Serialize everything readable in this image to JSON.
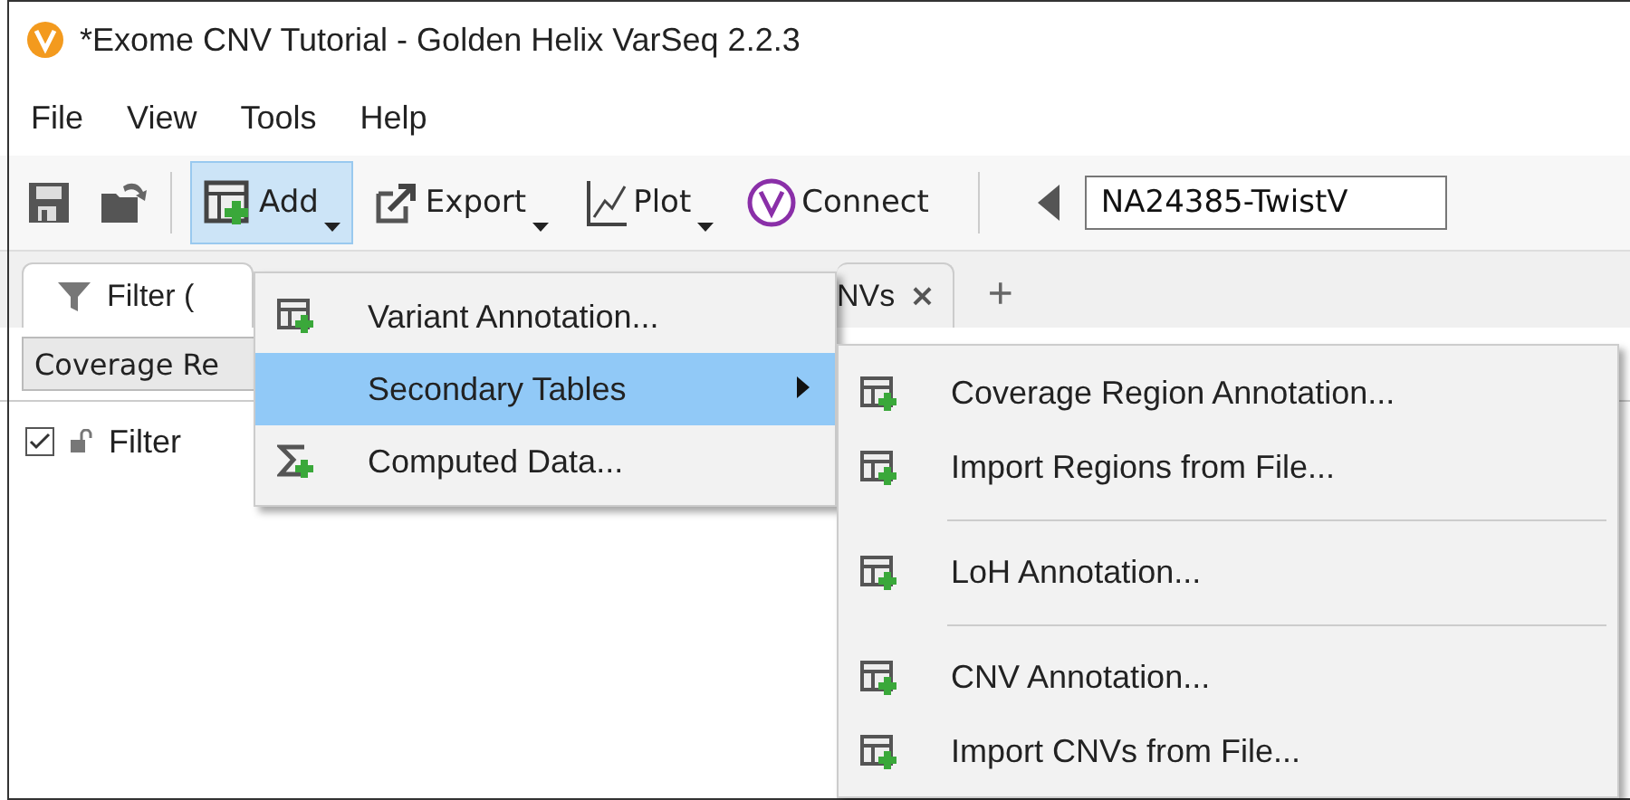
{
  "window": {
    "title": "*Exome CNV Tutorial - Golden Helix VarSeq 2.2.3"
  },
  "menu_bar": [
    {
      "label": "File"
    },
    {
      "label": "View"
    },
    {
      "label": "Tools"
    },
    {
      "label": "Help"
    }
  ],
  "toolbar": {
    "buttons": [
      {
        "kind": "add",
        "label": "Add",
        "selected": true,
        "dropdown": true
      },
      {
        "kind": "export",
        "label": "Export",
        "selected": false,
        "dropdown": true
      },
      {
        "kind": "plot",
        "label": "Plot",
        "selected": false,
        "dropdown": true
      },
      {
        "kind": "connect",
        "label": "Connect",
        "selected": false,
        "dropdown": false
      }
    ],
    "sample_field": {
      "value": "NA24385-TwistV"
    }
  },
  "tabs": [
    {
      "label": "Filter (",
      "selected": true
    },
    {
      "label": "NVs",
      "selected": false,
      "close": "×"
    }
  ],
  "add_tab": "+",
  "filter_bar": {
    "button": "Coverage Re"
  },
  "filter_row": {
    "checked": true,
    "label": "Filter"
  },
  "add_menu": [
    {
      "label": "Variant Annotation...",
      "kind": "table",
      "selected": false,
      "submenu": false
    },
    {
      "label": "Secondary Tables",
      "kind": "none",
      "selected": true,
      "submenu": true
    },
    {
      "label": "Computed Data...",
      "kind": "sum",
      "selected": false,
      "submenu": false
    }
  ],
  "secondary_menu": [
    {
      "items": [
        {
          "label": "Coverage Region Annotation..."
        },
        {
          "label": "Import Regions from File..."
        }
      ]
    },
    {
      "items": [
        {
          "label": "LoH Annotation..."
        }
      ]
    },
    {
      "items": [
        {
          "label": "CNV Annotation..."
        },
        {
          "label": "Import CNVs from File..."
        }
      ]
    }
  ]
}
